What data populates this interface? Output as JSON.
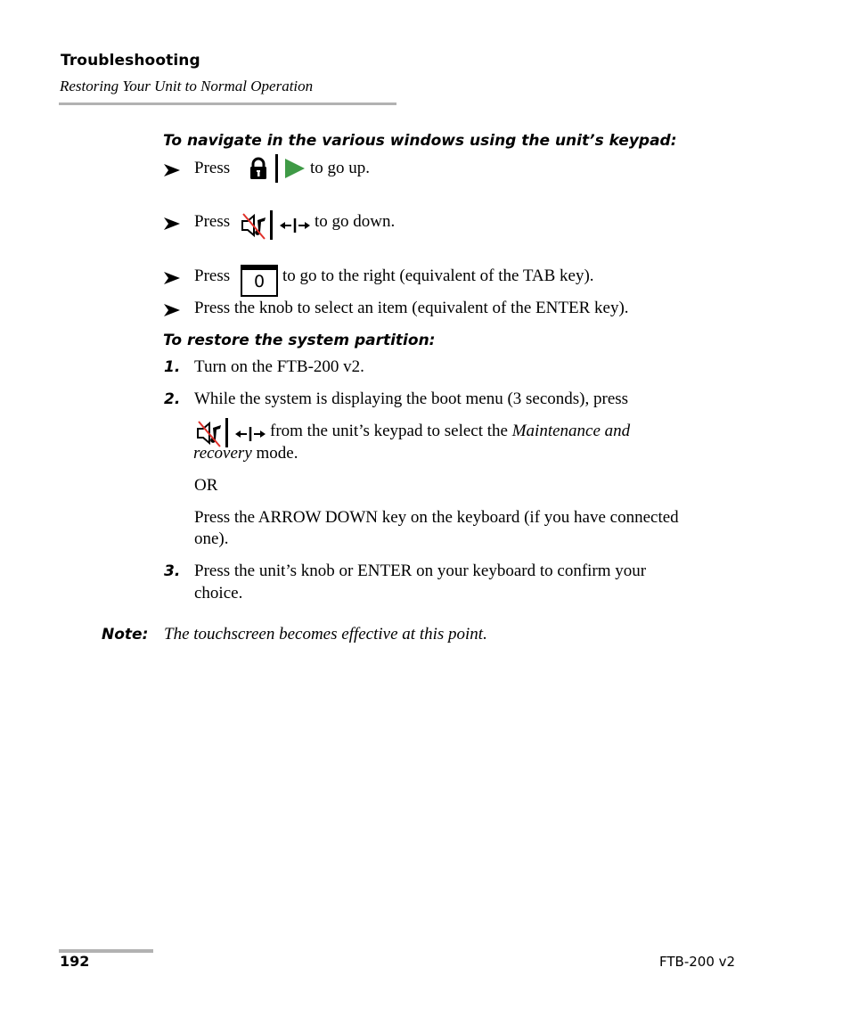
{
  "header": {
    "chapter_title": "Troubleshooting",
    "section_title": "Restoring Your Unit to Normal Operation"
  },
  "navigate_procedure": {
    "title": "To navigate in the various windows using the unit’s keypad:",
    "items": [
      {
        "prefix": "Press",
        "icons": [
          "lock-icon",
          "separator-bar",
          "play-arrow-icon"
        ],
        "suffix": "to go up."
      },
      {
        "prefix": "Press",
        "icons": [
          "mute-speaker-icon",
          "separator-bar",
          "left-right-arrows-icon"
        ],
        "suffix": "to go down."
      },
      {
        "prefix": "Press",
        "icons": [
          "zero-key-icon"
        ],
        "key_label": "0",
        "suffix": "to go to the right (equivalent of the TAB key)."
      },
      {
        "text": "Press the knob to select an item (equivalent of the ENTER key)."
      }
    ]
  },
  "restore_procedure": {
    "title": "To restore the system partition:",
    "steps": [
      {
        "number": "1.",
        "text": "Turn on the FTB-200 v2."
      },
      {
        "number": "2.",
        "text": "While the system is displaying the boot menu (3 seconds), press",
        "icons": [
          "mute-speaker-icon",
          "separator-bar",
          "left-right-arrows-icon"
        ],
        "cont_text": "from the unit’s keypad to select the",
        "emphasis": "Maintenance and recovery",
        "emphasis_line1": "Maintenance and",
        "emphasis_line2": "recovery",
        "end_text": "mode.",
        "or": "OR",
        "alt_text_line1": "Press the ARROW DOWN key on the keyboard (if you have connected",
        "alt_text_line2": "one)."
      },
      {
        "number": "3.",
        "text_line1": "Press the unit’s knob or ENTER on your keyboard to confirm your",
        "text_line2": "choice."
      }
    ]
  },
  "note": {
    "label": "Note:",
    "text": "The touchscreen becomes effective at this point."
  },
  "footer": {
    "page_number": "192",
    "document_name": "FTB-200 v2"
  },
  "colors": {
    "rule_gray": "#b2b2b2",
    "play_green": "#3f9a46",
    "mute_slash_red": "#e0302a"
  }
}
